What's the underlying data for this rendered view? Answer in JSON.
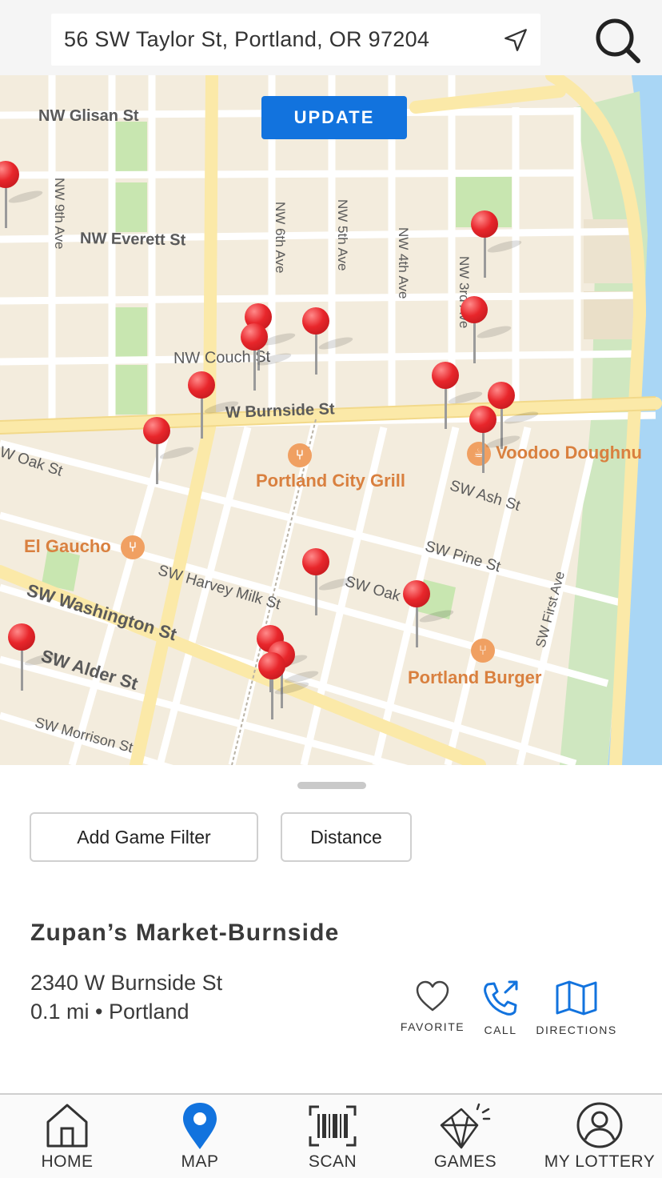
{
  "search": {
    "address": "56 SW Taylor St, Portland, OR 97204",
    "location_icon": "location-arrow-icon",
    "search_icon": "search-icon"
  },
  "map": {
    "update_label": "UPDATE",
    "streets": [
      "NW Glisan St",
      "NW Everett St",
      "NW Couch St",
      "W Burnside St",
      "NW 9th Ave",
      "NW 6th Ave",
      "NW 5th Ave",
      "NW 4th Ave",
      "NW 3rd Ave",
      "W Oak St",
      "SW Ash St",
      "SW Pine St",
      "SW Oak",
      "SW First Ave",
      "SW Harvey Milk St",
      "SW Washington St",
      "SW Alder St",
      "SW Morrison St"
    ],
    "places": [
      "Portland City Grill",
      "El Gaucho",
      "Voodoo Doughnu",
      "Portland Burger"
    ],
    "colors": {
      "land": "#f3ecdd",
      "road": "#ffffff",
      "major_road": "#fbe9a8",
      "park": "#c8e6b0",
      "water": "#a9d6f5",
      "pin": "#e8262b"
    }
  },
  "filters": {
    "add_game_filter": "Add Game Filter",
    "distance": "Distance"
  },
  "store": {
    "name": "Zupan’s Market-Burnside",
    "address": "2340 W Burnside St",
    "distance": "0.1 mi • Portland",
    "actions": [
      {
        "label": "FAVORITE",
        "icon": "heart-icon"
      },
      {
        "label": "CALL",
        "icon": "phone-call-icon"
      },
      {
        "label": "DIRECTIONS",
        "icon": "map-icon"
      }
    ]
  },
  "tabs": [
    {
      "label": "HOME",
      "icon": "home-icon"
    },
    {
      "label": "MAP",
      "icon": "map-pin-icon"
    },
    {
      "label": "SCAN",
      "icon": "barcode-scan-icon"
    },
    {
      "label": "GAMES",
      "icon": "diamond-icon"
    },
    {
      "label": "MY LOTTERY",
      "icon": "user-icon"
    }
  ],
  "accent_color": "#1273de"
}
